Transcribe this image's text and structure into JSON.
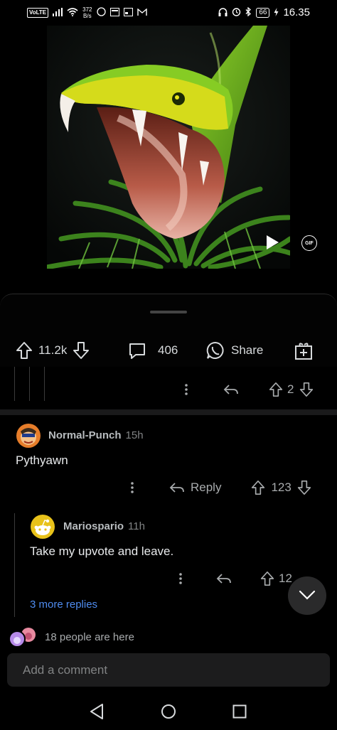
{
  "status_bar": {
    "volte": "VoLTE",
    "net_speed_value": "372",
    "net_speed_unit": "B/s",
    "battery": "66",
    "time": "16.35"
  },
  "media": {
    "gif_badge": "GIF"
  },
  "post_actions": {
    "upvotes": "11.2k",
    "comments": "406",
    "share_label": "Share"
  },
  "partial_comment": {
    "votes": "2"
  },
  "comment_1": {
    "username": "Normal-Punch",
    "age": "15h",
    "body": "Pythyawn",
    "reply_label": "Reply",
    "votes": "123"
  },
  "comment_2": {
    "username": "Mariospario",
    "age": "11h",
    "body": "Take my upvote and leave.",
    "votes": "12"
  },
  "more_replies": "3 more replies",
  "presence": "18 people are here",
  "comment_input": {
    "placeholder": "Add a comment"
  },
  "colors": {
    "link_blue": "#4f8cf0",
    "snake_green": "#7cc51f",
    "snake_yellow": "#e8e01a"
  }
}
